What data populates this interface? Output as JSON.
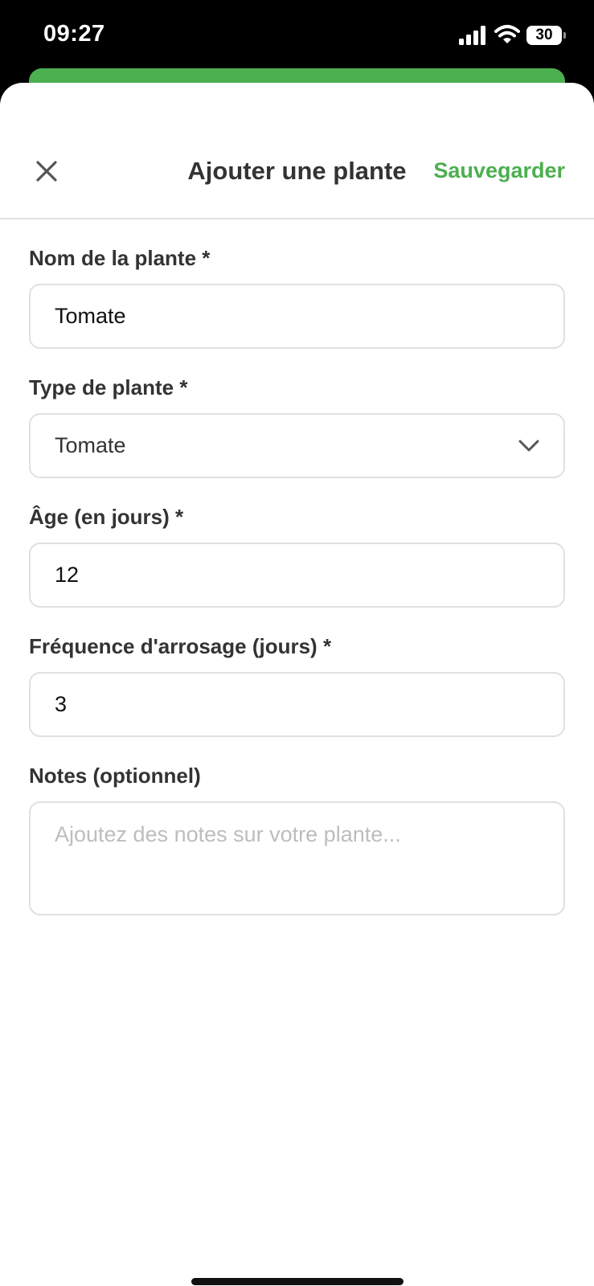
{
  "status_bar": {
    "time": "09:27",
    "battery": "30",
    "icons": [
      "signal-icon",
      "wifi-icon",
      "battery-icon"
    ]
  },
  "colors": {
    "accent": "#4caf50",
    "text": "#333333",
    "border": "#e0e0e0",
    "placeholder": "#bdbdbd"
  },
  "header": {
    "close_icon": "close-icon",
    "title": "Ajouter une plante",
    "save_label": "Sauvegarder"
  },
  "form": {
    "name": {
      "label": "Nom de la plante *",
      "value": "Tomate"
    },
    "type": {
      "label": "Type de plante *",
      "value": "Tomate",
      "icon": "chevron-down-icon"
    },
    "age": {
      "label": "Âge (en jours) *",
      "value": "12"
    },
    "watering": {
      "label": "Fréquence d'arrosage (jours) *",
      "value": "3"
    },
    "notes": {
      "label": "Notes (optionnel)",
      "value": "",
      "placeholder": "Ajoutez des notes sur votre plante..."
    }
  }
}
